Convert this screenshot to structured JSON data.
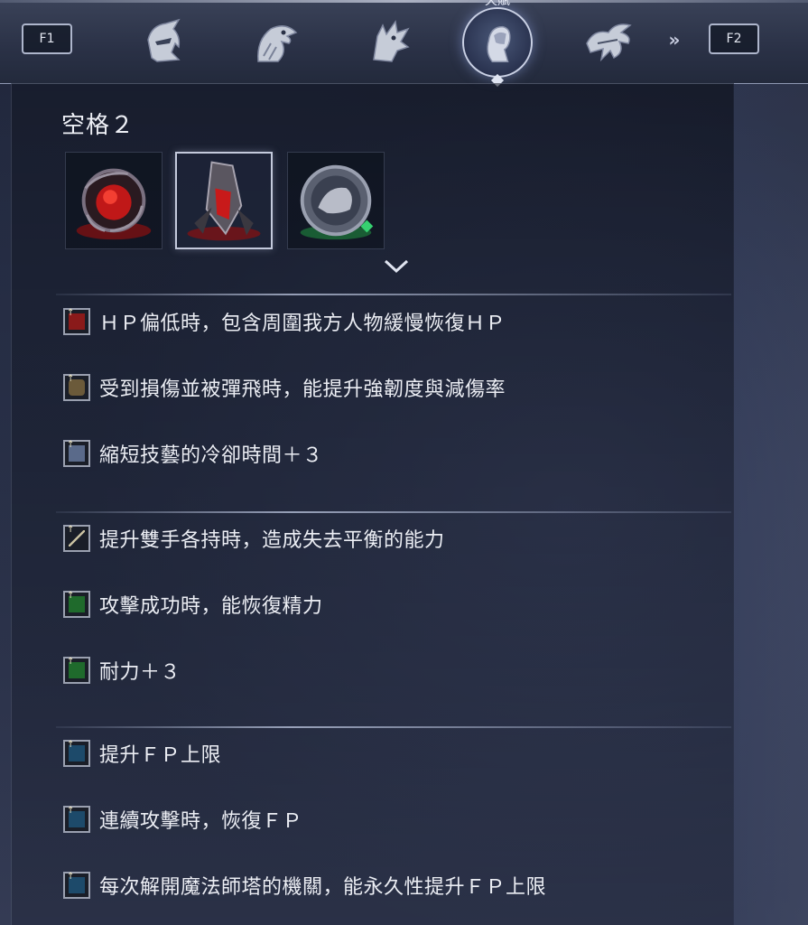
{
  "topbar": {
    "f1_label": "F1",
    "f2_label": "F2",
    "next_glyph": "»",
    "active_tab_label": "天賦",
    "tabs": [
      {
        "icon": "knight-helmet-icon"
      },
      {
        "icon": "eagle-head-icon"
      },
      {
        "icon": "wolf-head-icon"
      },
      {
        "icon": "woman-profile-icon"
      },
      {
        "icon": "dragon-emblem-icon"
      }
    ]
  },
  "slot": {
    "title": "空格２",
    "items": [
      {
        "icon": "red-orb-thorns-icon",
        "glow": "#c81818"
      },
      {
        "icon": "red-crystal-shard-icon",
        "glow": "#d02020"
      },
      {
        "icon": "silver-medallion-icon",
        "glow": "#2fb060"
      }
    ]
  },
  "effects": [
    {
      "text": "ＨＰ偏低時，包含周圍我方人物緩慢恢復ＨＰ",
      "icon": "red-square-icon",
      "color": "#8a1a1a"
    },
    {
      "text": "受到損傷並被彈飛時，能提升強韌度與減傷率",
      "icon": "armor-icon",
      "color": "#6b5a3a"
    },
    {
      "text": "縮短技藝的冷卻時間＋３",
      "icon": "sparkle-icon",
      "color": "#5a6a8a"
    },
    {
      "text": "提升雙手各持時，造成失去平衡的能力",
      "icon": "sword-icon",
      "color": "#5a5040"
    },
    {
      "text": "攻擊成功時，能恢復精力",
      "icon": "green-square-icon",
      "color": "#1f6a2c"
    },
    {
      "text": "耐力＋３",
      "icon": "green-square-icon",
      "color": "#1f6a2c"
    },
    {
      "text": "提升ＦＰ上限",
      "icon": "blue-square-icon",
      "color": "#1d4a6a"
    },
    {
      "text": "連續攻擊時，恢復ＦＰ",
      "icon": "blue-square-icon",
      "color": "#1d4a6a"
    },
    {
      "text": "每次解開魔法師塔的機關，能永久性提升ＦＰ上限",
      "icon": "blue-square-icon",
      "color": "#1d4a6a"
    }
  ]
}
